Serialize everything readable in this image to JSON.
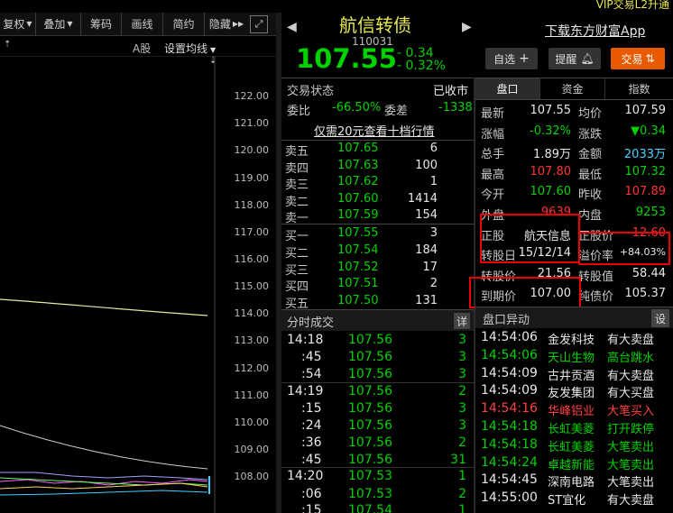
{
  "top_bar": {
    "vip": "VIP交易L2升通"
  },
  "toolbar": {
    "items": [
      "复权",
      "叠加",
      "筹码",
      "画线",
      "简约",
      "隐藏"
    ],
    "fuquan": "复权",
    "diejia": "叠加",
    "chouma": "筹码",
    "huaxian": "画线",
    "jianyue": "简约",
    "yincang": "隐藏"
  },
  "chart": {
    "a_gu": "A股",
    "ma_setting": "设置均线",
    "prices": [
      "122.00",
      "121.00",
      "120.00",
      "119.00",
      "118.00",
      "117.00",
      "116.00",
      "115.00",
      "114.00",
      "113.00",
      "112.00",
      "111.00",
      "110.00",
      "109.00",
      "108.00"
    ]
  },
  "quote": {
    "name": "航信转债",
    "code": "110031",
    "price": "107.55",
    "change": "- 0.34",
    "change_pct": "- 0.32%",
    "download": "下载东方财富App",
    "zixuan": "自选",
    "tixing": "提醒",
    "jiaoyi": "交易"
  },
  "trade_state": {
    "label": "交易状态",
    "value": "已收市",
    "weibi_label": "委比",
    "weibi": "-66.50%",
    "weicha_label": "委差",
    "weicha": "-1338",
    "promo": "仅需20元查看十档行情"
  },
  "sell": [
    {
      "label": "卖五",
      "price": "107.65",
      "vol": "6"
    },
    {
      "label": "卖四",
      "price": "107.63",
      "vol": "100"
    },
    {
      "label": "卖三",
      "price": "107.62",
      "vol": "1"
    },
    {
      "label": "卖二",
      "price": "107.60",
      "vol": "1414"
    },
    {
      "label": "卖一",
      "price": "107.59",
      "vol": "154"
    }
  ],
  "buy": [
    {
      "label": "买一",
      "price": "107.55",
      "vol": "3"
    },
    {
      "label": "买二",
      "price": "107.54",
      "vol": "184"
    },
    {
      "label": "买三",
      "price": "107.52",
      "vol": "17"
    },
    {
      "label": "买四",
      "price": "107.51",
      "vol": "2"
    },
    {
      "label": "买五",
      "price": "107.50",
      "vol": "131"
    }
  ],
  "tabs": {
    "pankou": "盘口",
    "zijin": "资金",
    "zhishu": "指数"
  },
  "stats": [
    {
      "l1": "最新",
      "v1": "107.55",
      "l2": "均价",
      "v2": "107.59"
    },
    {
      "l1": "涨幅",
      "v1": "-0.32%",
      "l2": "涨跌",
      "v2": "▼0.34"
    },
    {
      "l1": "总手",
      "v1": "1.89万",
      "l2": "金额",
      "v2": "2033万"
    },
    {
      "l1": "最高",
      "v1": "107.80",
      "l2": "最低",
      "v2": "107.32"
    },
    {
      "l1": "今开",
      "v1": "107.60",
      "l2": "昨收",
      "v2": "107.89"
    },
    {
      "l1": "外盘",
      "v1": "9639",
      "l2": "内盘",
      "v2": "9253"
    },
    {
      "l1": "正股",
      "v1": "航天信息",
      "l2": "正股价",
      "v2": "12.60"
    },
    {
      "l1": "转股日",
      "v1": "15/12/14",
      "l2": "溢价率",
      "v2": "+84.03%"
    },
    {
      "l1": "转股价",
      "v1": "21.56",
      "l2": "转股值",
      "v2": "58.44"
    },
    {
      "l1": "到期价",
      "v1": "107.00",
      "l2": "纯债价",
      "v2": "105.37"
    }
  ],
  "ticks": {
    "title": "分时成交",
    "detail": "详",
    "rows": [
      {
        "t": "14:18",
        "p": "107.56",
        "v": "3"
      },
      {
        "t": ":45",
        "p": "107.56",
        "v": "3"
      },
      {
        "t": ":54",
        "p": "107.56",
        "v": "3"
      },
      {
        "t": "14:19",
        "p": "107.56",
        "v": "2"
      },
      {
        "t": ":15",
        "p": "107.56",
        "v": "3"
      },
      {
        "t": ":24",
        "p": "107.56",
        "v": "3"
      },
      {
        "t": ":36",
        "p": "107.56",
        "v": "2"
      },
      {
        "t": ":45",
        "p": "107.56",
        "v": "31"
      },
      {
        "t": "14:20",
        "p": "107.53",
        "v": "1"
      },
      {
        "t": ":06",
        "p": "107.53",
        "v": "2"
      },
      {
        "t": ":15",
        "p": "107.54",
        "v": "1"
      }
    ]
  },
  "anomaly": {
    "title": "盘口异动",
    "set": "设",
    "rows": [
      {
        "t": "14:54:06",
        "n": "金发科技",
        "a": "有大卖盘",
        "c": "white"
      },
      {
        "t": "14:54:06",
        "n": "天山生物",
        "a": "高台跳水",
        "c": "green"
      },
      {
        "t": "14:54:09",
        "n": "古井贡酒",
        "a": "有大卖盘",
        "c": "white"
      },
      {
        "t": "14:54:09",
        "n": "友发集团",
        "a": "有大买盘",
        "c": "white"
      },
      {
        "t": "14:54:16",
        "n": "华峰铝业",
        "a": "大笔买入",
        "c": "red"
      },
      {
        "t": "14:54:18",
        "n": "长虹美菱",
        "a": "打开跌停",
        "c": "green"
      },
      {
        "t": "14:54:18",
        "n": "长虹美菱",
        "a": "大笔卖出",
        "c": "green"
      },
      {
        "t": "14:54:24",
        "n": "卓越新能",
        "a": "大笔卖出",
        "c": "green"
      },
      {
        "t": "14:54:45",
        "n": "深南电路",
        "a": "大笔卖出",
        "c": "white"
      },
      {
        "t": "14:55:00",
        "n": "ST宜化",
        "a": "有大卖盘",
        "c": "white"
      }
    ]
  }
}
